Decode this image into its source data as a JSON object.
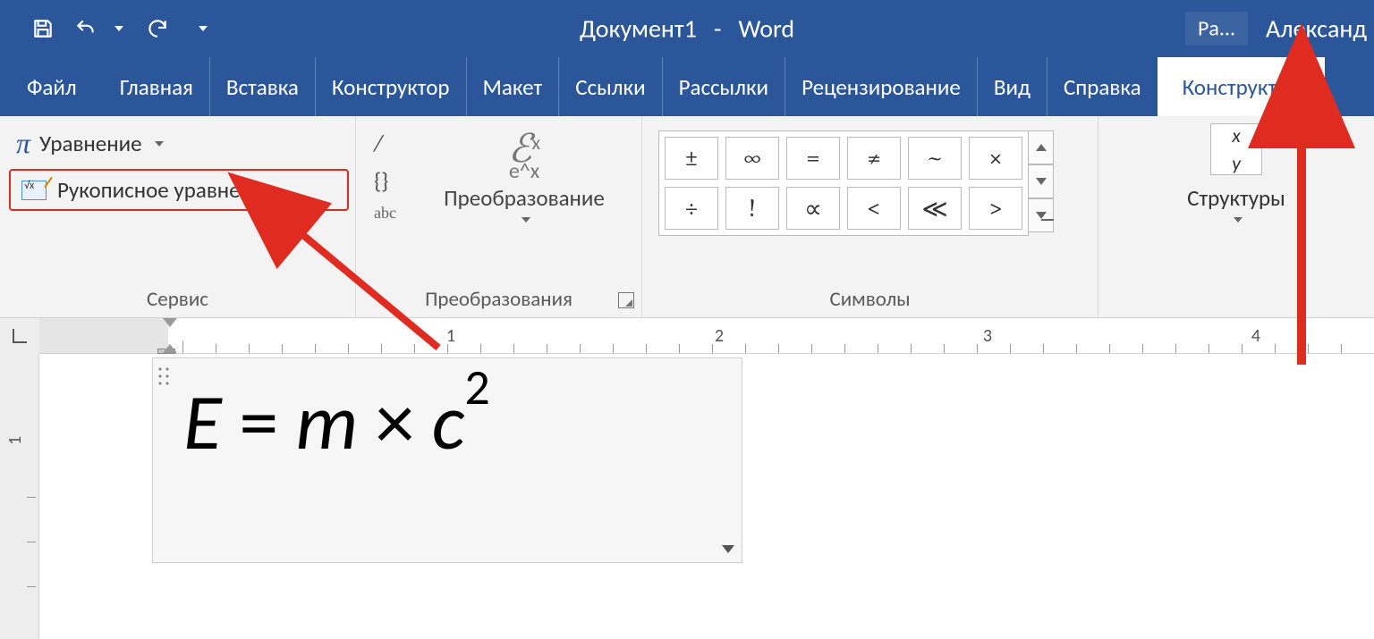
{
  "title": {
    "doc": "Документ1",
    "sep": "-",
    "app": "Word"
  },
  "title_right": {
    "badge": "Ра...",
    "user": "Александ"
  },
  "tabs": {
    "file": "Файл",
    "home": "Главная",
    "insert": "Вставка",
    "design": "Конструктор",
    "layout": "Макет",
    "references": "Ссылки",
    "mailings": "Рассылки",
    "review": "Рецензирование",
    "view": "Вид",
    "help": "Справка",
    "equation_design": "Конструктор"
  },
  "ribbon": {
    "service": {
      "equation": "Уравнение",
      "ink": "Рукописное уравнение",
      "group": "Сервис"
    },
    "conversion": {
      "label": "Преобразование",
      "group": "Преобразования",
      "ex_top": "ℰ",
      "ex_sup": "x",
      "ex_bot": "e^x",
      "abc": "abc"
    },
    "symbols": {
      "group": "Символы",
      "row1": [
        "±",
        "∞",
        "=",
        "≠",
        "~",
        "×"
      ],
      "row2": [
        "÷",
        "!",
        "∝",
        "<",
        "≪",
        ">"
      ]
    },
    "structures": {
      "group": "Структуры",
      "label": "Структуры",
      "frac_top": "x",
      "frac_bot": "y"
    }
  },
  "ruler": {
    "n1": "1",
    "n2": "2",
    "n3": "3",
    "n4": "4",
    "v1": "1"
  },
  "equation": {
    "E": "E",
    "eq": "=",
    "m": "m",
    "times": "×",
    "c": "c",
    "two": "2"
  }
}
